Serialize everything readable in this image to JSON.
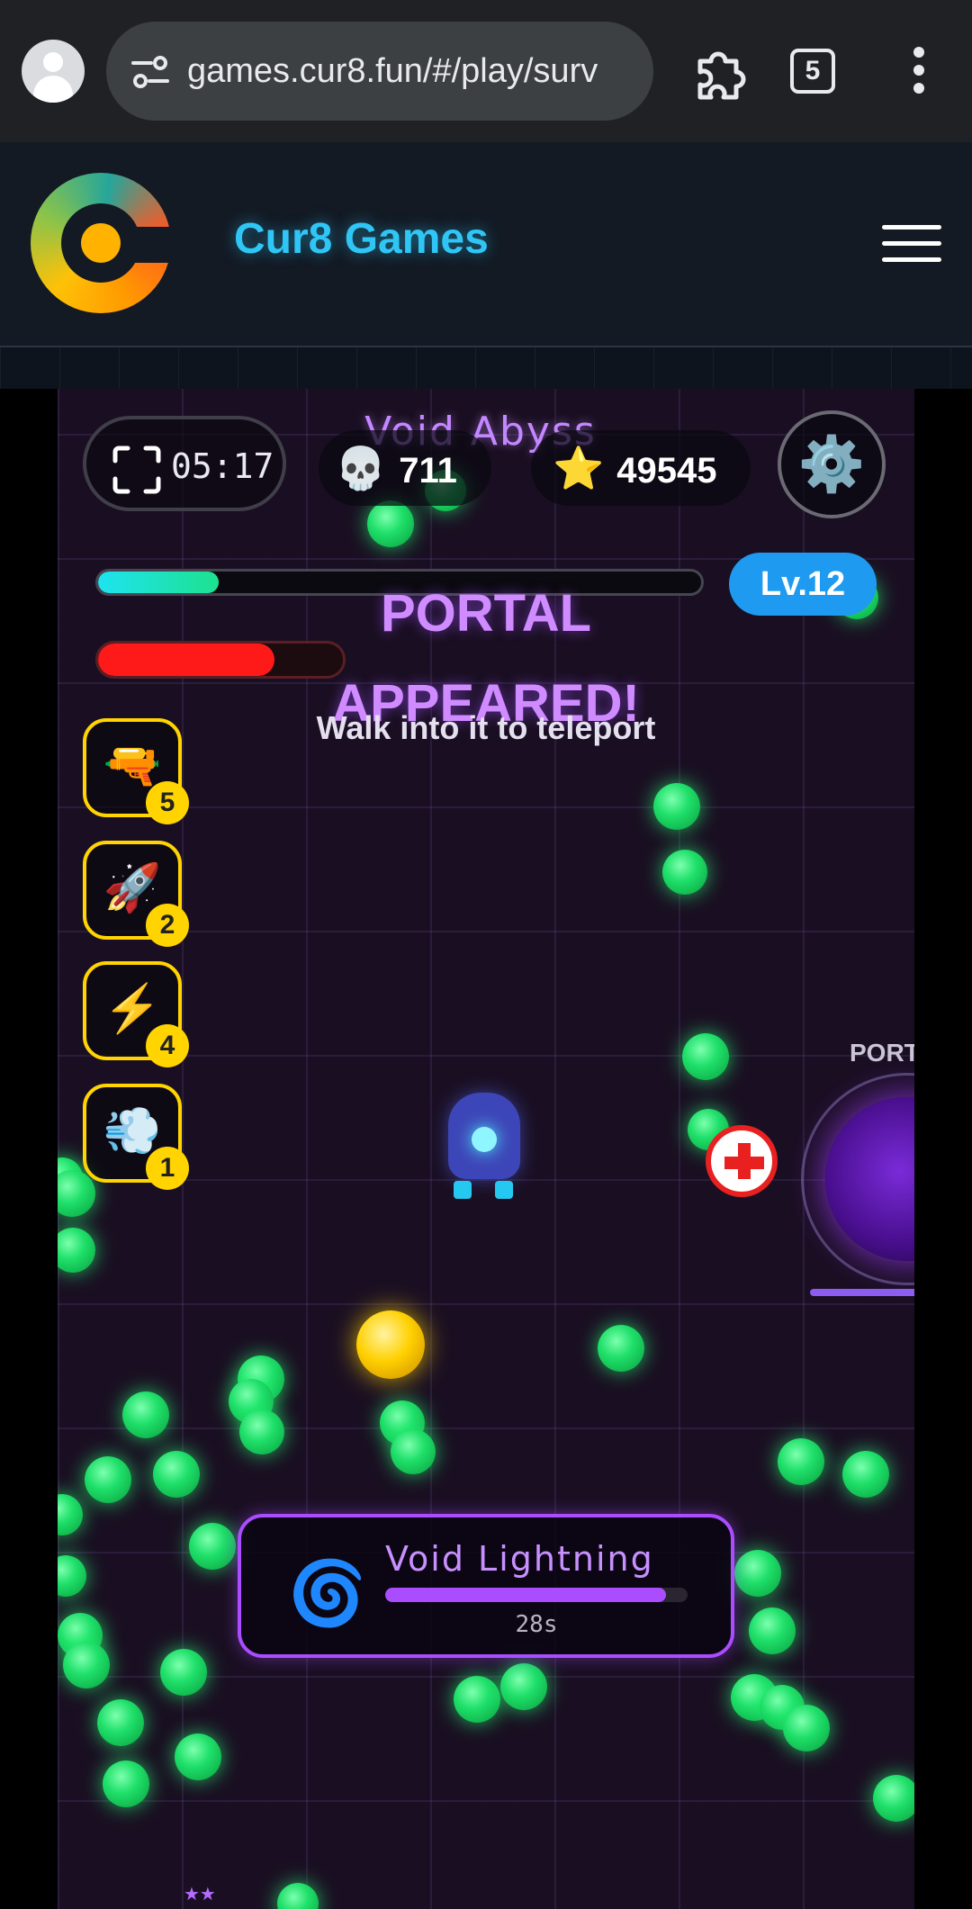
{
  "browser": {
    "url": "games.cur8.fun/#/play/surv",
    "tab_count": "5"
  },
  "site": {
    "title": "Cur8 Games"
  },
  "game": {
    "title": "Void Abyss",
    "timer": "05:17",
    "kills": "711",
    "kills_icon": "💀",
    "score": "49545",
    "score_icon": "⭐",
    "settings_icon": "⚙️",
    "level": "Lv.12",
    "xp_fraction": 0.2,
    "hp_fraction": 0.72,
    "banner_title_line1": "PORTAL",
    "banner_title_line2": "APPEARED!",
    "banner_subtitle": "Walk into it to teleport",
    "portal_label": "PORT",
    "abilities": [
      {
        "icon": "🔫",
        "count": "5"
      },
      {
        "icon": "🚀",
        "count": "2"
      },
      {
        "icon": "⚡",
        "count": "4"
      },
      {
        "icon": "💨",
        "count": "1"
      }
    ],
    "buff": {
      "icon": "🌀",
      "name": "Void Lightning",
      "seconds": "28s",
      "remaining_fraction": 0.93
    },
    "minimap_stars": "★★"
  },
  "colors": {
    "accent": "#2fc6f6",
    "buff_purple": "#a94dff",
    "level_badge": "#1e9bf0",
    "hp": "#ff1a1a",
    "orb": "#1fe06a"
  }
}
